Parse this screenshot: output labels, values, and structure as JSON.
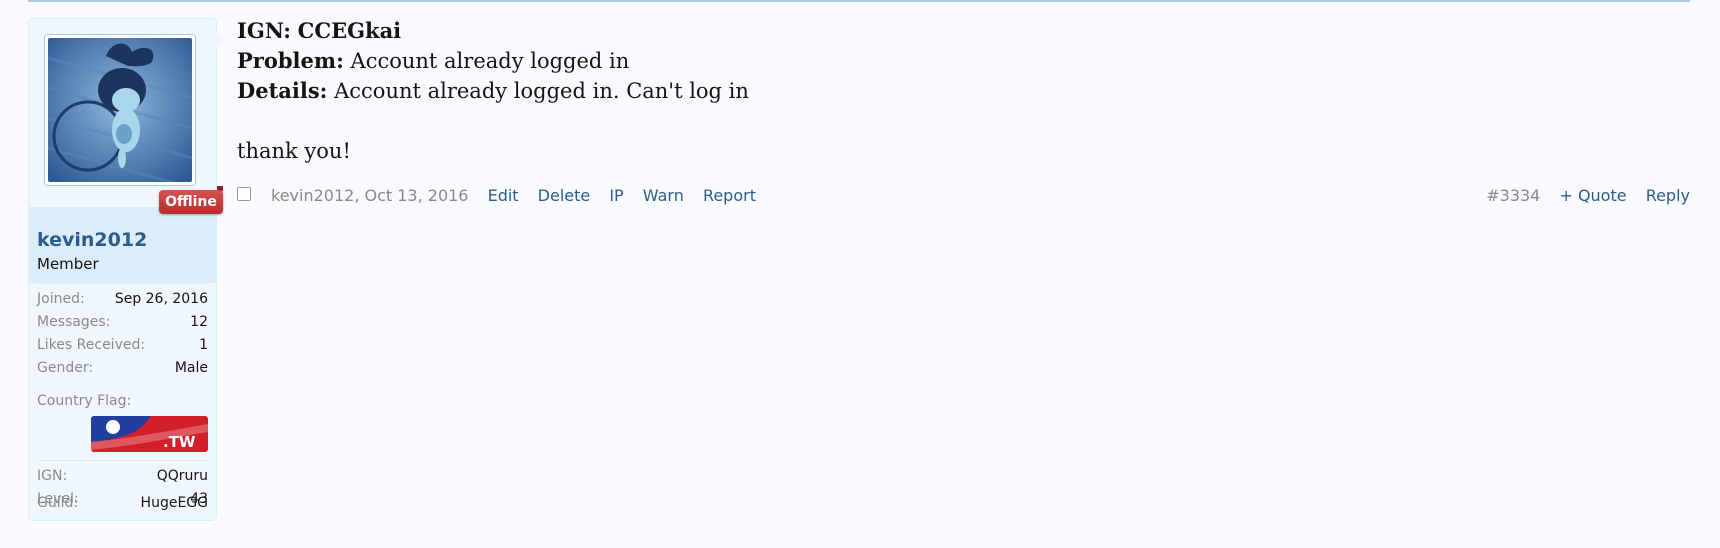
{
  "sidebar": {
    "status_badge": "Offline",
    "username": "kevin2012",
    "usertitle": "Member",
    "stats": [
      {
        "label": "Joined:",
        "value": "Sep 26, 2016"
      },
      {
        "label": "Messages:",
        "value": "12"
      },
      {
        "label": "Likes Received:",
        "value": "1"
      },
      {
        "label": "Gender:",
        "value": "Male"
      }
    ],
    "country_flag_label": "Country Flag:",
    "flag_text": ".TW",
    "custom": [
      {
        "label": "IGN:",
        "value": "QQruru"
      },
      {
        "label": "Level:",
        "value": "43"
      },
      {
        "label": "Guild:",
        "value": "HugeEGG"
      }
    ]
  },
  "message": {
    "ign_label": "IGN:",
    "ign_value": "CCEGkai",
    "problem_label": "Problem:",
    "problem_value": "Account already logged in",
    "details_label": "Details:",
    "details_value": "Account already logged in. Can't log in",
    "closing": "thank you!"
  },
  "meta": {
    "author": "kevin2012",
    "date": "Oct 13, 2016",
    "actions": [
      "Edit",
      "Delete",
      "IP",
      "Warn",
      "Report"
    ],
    "post_number": "#3334",
    "quote_label": "+ Quote",
    "reply_label": "Reply"
  },
  "colors": {
    "link": "#2b5e8e",
    "badge": "#c0392b",
    "sidebar_bg": "#f0f7fc"
  }
}
